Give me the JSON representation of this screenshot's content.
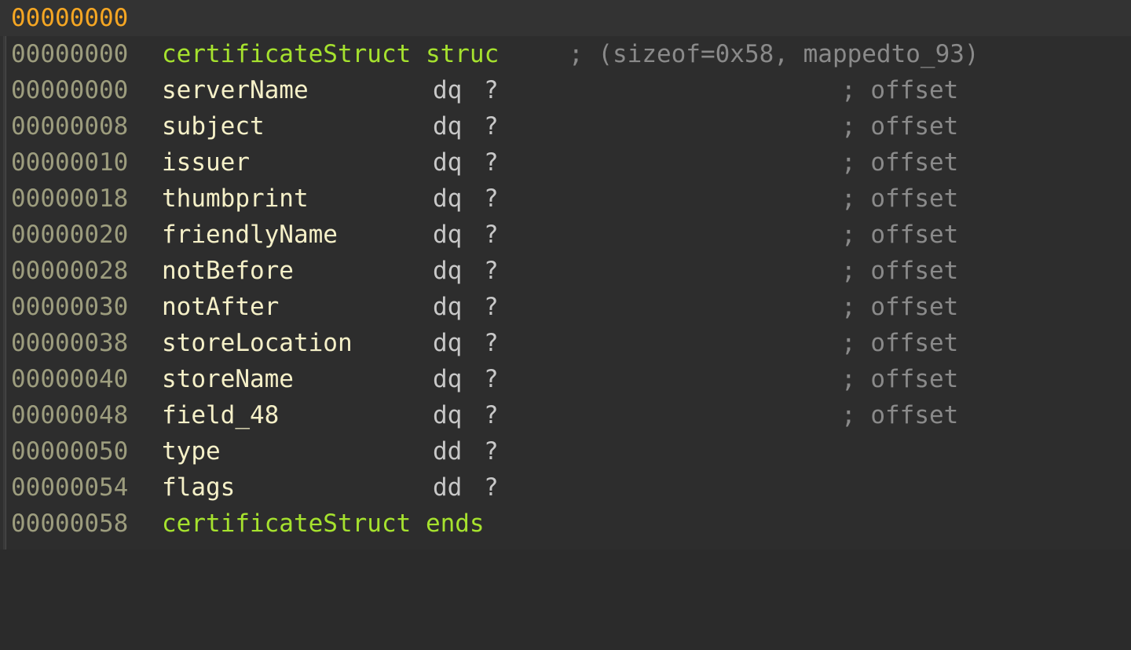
{
  "view": {
    "name": "ida-structure-view",
    "colors": {
      "background": "#2d2d2d",
      "header_line_background": "#333333",
      "gutter": "#3a3a3a",
      "address": "#9d9d7e",
      "address_highlight": "#f5a623",
      "field_name": "#f5f0c8",
      "struct_keyword": "#a6e22e",
      "type_keyword": "#c8c8c8",
      "comment": "#8a8a8a"
    }
  },
  "header": {
    "address": "00000000"
  },
  "struct": {
    "declaration_address": "00000000",
    "declaration_text": "certificateStruct struc",
    "declaration_comment": "; (sizeof=0x58, mappedto_93)",
    "end_address": "00000058",
    "end_text": "certificateStruct ends"
  },
  "fields": [
    {
      "address": "00000000",
      "name": "serverName",
      "type": "dq",
      "value": "?",
      "comment": "; offset"
    },
    {
      "address": "00000008",
      "name": "subject",
      "type": "dq",
      "value": "?",
      "comment": "; offset"
    },
    {
      "address": "00000010",
      "name": "issuer",
      "type": "dq",
      "value": "?",
      "comment": "; offset"
    },
    {
      "address": "00000018",
      "name": "thumbprint",
      "type": "dq",
      "value": "?",
      "comment": "; offset"
    },
    {
      "address": "00000020",
      "name": "friendlyName",
      "type": "dq",
      "value": "?",
      "comment": "; offset"
    },
    {
      "address": "00000028",
      "name": "notBefore",
      "type": "dq",
      "value": "?",
      "comment": "; offset"
    },
    {
      "address": "00000030",
      "name": "notAfter",
      "type": "dq",
      "value": "?",
      "comment": "; offset"
    },
    {
      "address": "00000038",
      "name": "storeLocation",
      "type": "dq",
      "value": "?",
      "comment": "; offset"
    },
    {
      "address": "00000040",
      "name": "storeName",
      "type": "dq",
      "value": "?",
      "comment": "; offset"
    },
    {
      "address": "00000048",
      "name": "field_48",
      "type": "dq",
      "value": "?",
      "comment": "; offset"
    },
    {
      "address": "00000050",
      "name": "type",
      "type": "dd",
      "value": "?",
      "comment": ""
    },
    {
      "address": "00000054",
      "name": "flags",
      "type": "dd",
      "value": "?",
      "comment": ""
    }
  ]
}
